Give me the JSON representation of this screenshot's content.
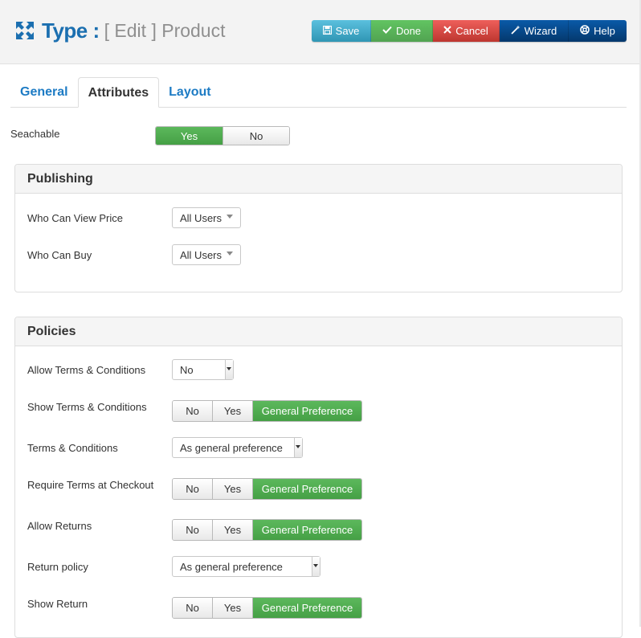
{
  "header": {
    "title_bold": "Type :",
    "title_rest": "[ Edit ] Product",
    "toolbar": [
      {
        "label": "Save",
        "icon": "save-icon"
      },
      {
        "label": "Done",
        "icon": "check-icon"
      },
      {
        "label": "Cancel",
        "icon": "close-icon"
      },
      {
        "label": "Wizard",
        "icon": "wand-icon"
      },
      {
        "label": "Help",
        "icon": "lifebuoy-icon"
      }
    ]
  },
  "tabs": [
    {
      "label": "General"
    },
    {
      "label": "Attributes"
    },
    {
      "label": "Layout"
    }
  ],
  "searchable": {
    "label": "Seachable",
    "options": [
      "Yes",
      "No"
    ],
    "selected": "Yes"
  },
  "publishing": {
    "title": "Publishing",
    "rows": [
      {
        "label": "Who Can View Price",
        "value": "All Users"
      },
      {
        "label": "Who Can Buy",
        "value": "All Users"
      }
    ]
  },
  "policies": {
    "title": "Policies",
    "rows": [
      {
        "label": "Allow Terms & Conditions",
        "value": "No"
      },
      {
        "label": "Show Terms & Conditions",
        "options": [
          "No",
          "Yes",
          "General Preference"
        ],
        "selected": "General Preference"
      },
      {
        "label": "Terms & Conditions",
        "value": "As general preference"
      },
      {
        "label": "Require Terms at Checkout",
        "options": [
          "No",
          "Yes",
          "General Preference"
        ],
        "selected": "General Preference"
      },
      {
        "label": "Allow Returns",
        "options": [
          "No",
          "Yes",
          "General Preference"
        ],
        "selected": "General Preference"
      },
      {
        "label": "Return policy",
        "value": "As general preference"
      },
      {
        "label": "Show Return",
        "options": [
          "No",
          "Yes",
          "General Preference"
        ],
        "selected": "General Preference"
      }
    ]
  },
  "colors": {
    "accent": "#1b6fb0",
    "success": "#51a351",
    "danger": "#bd362f",
    "info": "#2f96b4",
    "primary": "#04386c"
  }
}
